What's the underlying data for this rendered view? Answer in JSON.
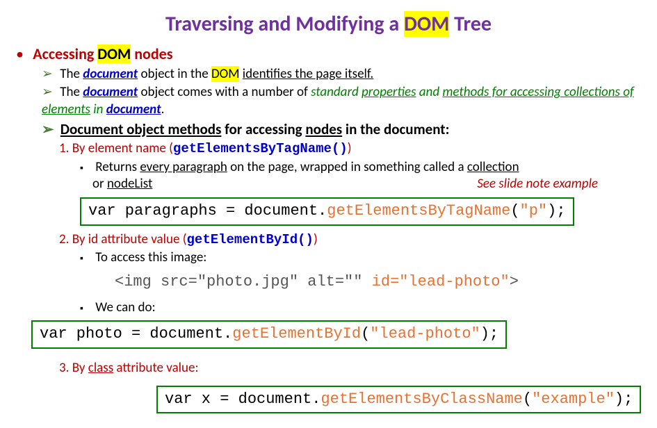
{
  "title": {
    "pre": "Traversing and Modifying a ",
    "hl": "DOM",
    "post": " Tree"
  },
  "h1": {
    "pre": "Accessing ",
    "hl": "DOM",
    "post": " nodes"
  },
  "b1": {
    "pre": "The ",
    "doc": "document",
    "mid1": " object in the ",
    "hl": "DOM",
    "mid2": " ",
    "u": "identifies the page itself."
  },
  "b2": {
    "pre": "The ",
    "doc": "document",
    "mid": " object comes with a number of ",
    "g1": "standard ",
    "g1u": "properties",
    "g2": " and ",
    "g2u": "methods for accessing collections of elements",
    "g3": " in ",
    "doc2": "document",
    "end": "."
  },
  "b3": {
    "u1": "Document object methods",
    "mid": " for accessing ",
    "u2": "nodes",
    "end": " in the document:"
  },
  "m1": {
    "num": "1.",
    "txt": " By element name (",
    "code": "getElementsByTagName()",
    "end": ")"
  },
  "m1detail": {
    "pre": "Returns ",
    "u1": "every paragraph",
    "mid": " on the page, wrapped in something called a ",
    "u2": "collection",
    "line2pre": "or ",
    "u3": "nodeList"
  },
  "note": "See slide note example",
  "code1": {
    "a": "var paragraphs = document.",
    "b": "getElementsByTagName",
    "c": "(",
    "d": "\"p\"",
    "e": ");"
  },
  "m2": {
    "num": "2.",
    "txt": " By id attribute value (",
    "code": "getElementById()",
    "end": ")"
  },
  "m2a": "To access this image:",
  "code2": {
    "a": "<img src=\"photo.jpg\" alt=\"\" ",
    "b": "id=\"lead-photo\"",
    "c": ">"
  },
  "m2b": "We can do:",
  "code3": {
    "a": "var photo = document.",
    "b": "getElementById",
    "c": "(",
    "d": "\"lead-photo\"",
    "e": ");"
  },
  "m3": {
    "num": "3.",
    "pre": " By ",
    "u": "class",
    "post": " attribute value:"
  },
  "code4": {
    "a": "var x = document.",
    "b": "getElementsByClassName",
    "c": "(",
    "d": "\"example\"",
    "e": ");"
  }
}
